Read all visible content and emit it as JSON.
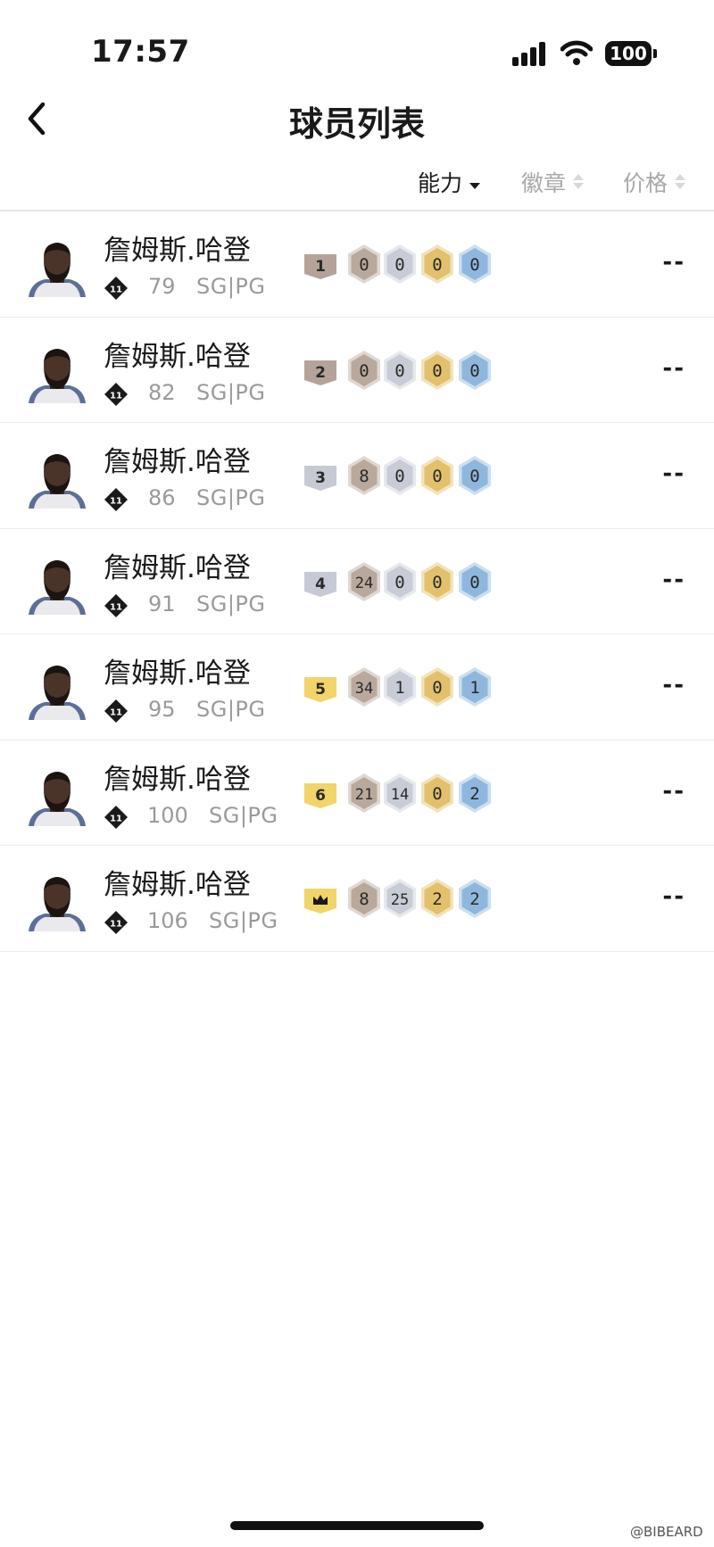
{
  "status_bar": {
    "time": "17:57",
    "battery": "100"
  },
  "header": {
    "title": "球员列表",
    "back_icon": "chevron-left-icon"
  },
  "sort_tabs": [
    {
      "label": "能力",
      "active": true,
      "direction": "desc"
    },
    {
      "label": "徽章",
      "active": false
    },
    {
      "label": "价格",
      "active": false
    }
  ],
  "badge_colors": {
    "bronze": "#b9a99c",
    "silver": "#c7ccd6",
    "gold": "#e2c06c",
    "hof": "#8fb7de"
  },
  "players": [
    {
      "name": "詹姆斯.哈登",
      "rating": "79",
      "positions": "SG|PG",
      "grade": "1",
      "grade_style": "bronze",
      "badges": [
        "0",
        "0",
        "0",
        "0"
      ],
      "price": "--"
    },
    {
      "name": "詹姆斯.哈登",
      "rating": "82",
      "positions": "SG|PG",
      "grade": "2",
      "grade_style": "bronze",
      "badges": [
        "0",
        "0",
        "0",
        "0"
      ],
      "price": "--"
    },
    {
      "name": "詹姆斯.哈登",
      "rating": "86",
      "positions": "SG|PG",
      "grade": "3",
      "grade_style": "silver",
      "badges": [
        "8",
        "0",
        "0",
        "0"
      ],
      "price": "--"
    },
    {
      "name": "詹姆斯.哈登",
      "rating": "91",
      "positions": "SG|PG",
      "grade": "4",
      "grade_style": "silver",
      "badges": [
        "24",
        "0",
        "0",
        "0"
      ],
      "price": "--"
    },
    {
      "name": "詹姆斯.哈登",
      "rating": "95",
      "positions": "SG|PG",
      "grade": "5",
      "grade_style": "gold",
      "badges": [
        "34",
        "1",
        "0",
        "1"
      ],
      "price": "--"
    },
    {
      "name": "詹姆斯.哈登",
      "rating": "100",
      "positions": "SG|PG",
      "grade": "6",
      "grade_style": "gold",
      "badges": [
        "21",
        "14",
        "0",
        "2"
      ],
      "price": "--"
    },
    {
      "name": "詹姆斯.哈登",
      "rating": "106",
      "positions": "SG|PG",
      "grade": "",
      "grade_style": "crown",
      "badges": [
        "8",
        "25",
        "2",
        "2"
      ],
      "price": "--"
    }
  ],
  "watermark": "@BIBEARD"
}
